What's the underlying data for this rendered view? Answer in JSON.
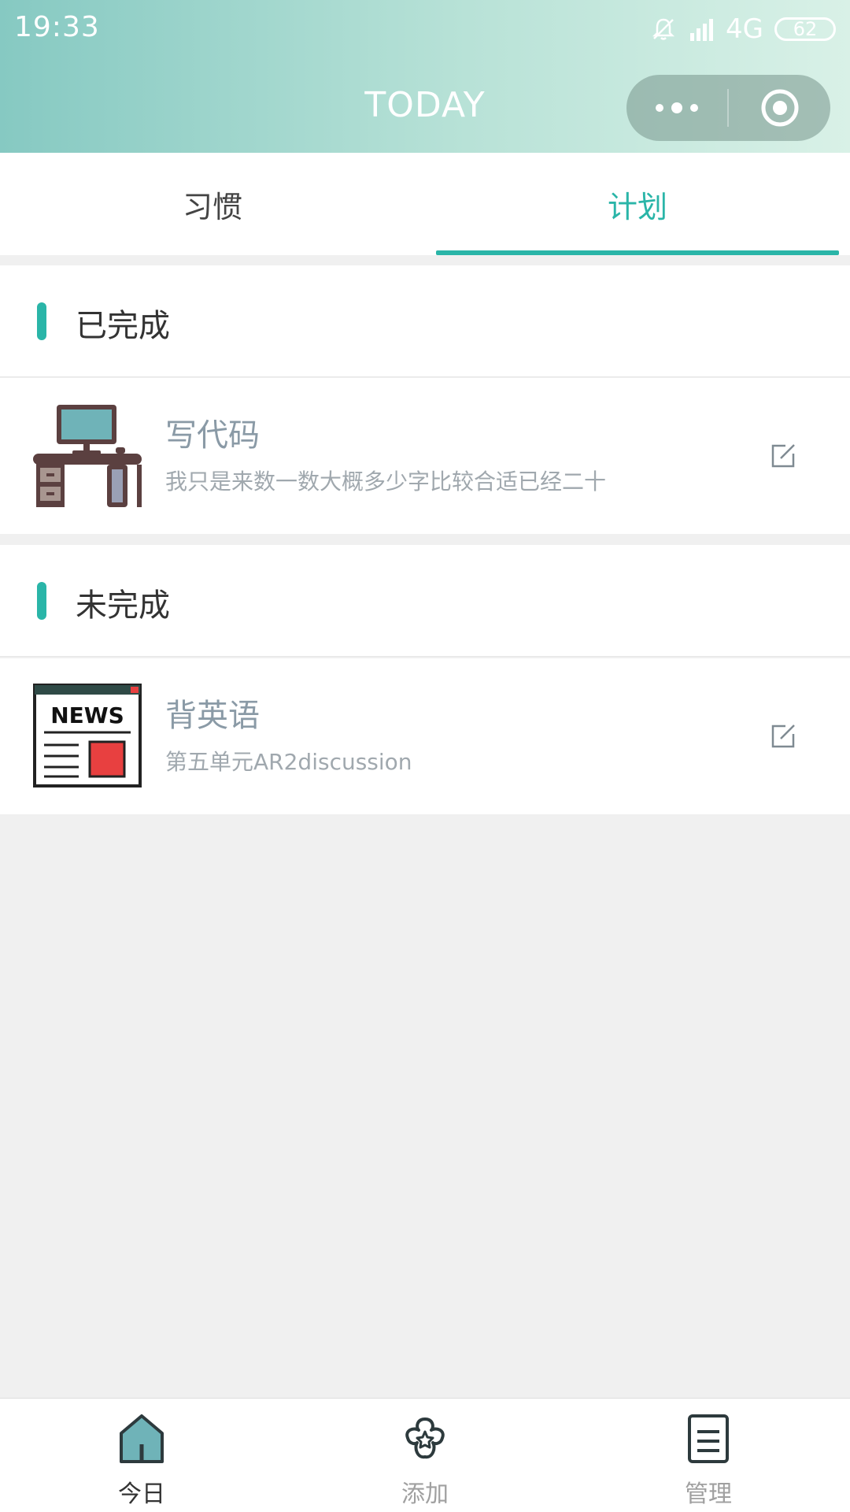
{
  "status_bar": {
    "time": "19:33",
    "network": "4G",
    "battery": "62"
  },
  "header": {
    "title": "TODAY"
  },
  "tabs": [
    {
      "label": "习惯",
      "active": false
    },
    {
      "label": "计划",
      "active": true
    }
  ],
  "sections": [
    {
      "title": "已完成",
      "items": [
        {
          "title": "写代码",
          "subtitle": "我只是来数一数大概多少字比较合适已经二十",
          "icon": "computer-desk-icon"
        }
      ]
    },
    {
      "title": "未完成",
      "items": [
        {
          "title": "背英语",
          "subtitle": "第五单元AR2discussion",
          "icon": "newspaper-icon",
          "icon_text": "NEWS"
        }
      ]
    }
  ],
  "bottom_nav": [
    {
      "label": "今日",
      "icon": "home-icon",
      "active": true
    },
    {
      "label": "添加",
      "icon": "flower-add-icon",
      "active": false
    },
    {
      "label": "管理",
      "icon": "document-icon",
      "active": false
    }
  ],
  "colors": {
    "accent": "#2ab5a8",
    "header_start": "#86c9c2",
    "header_end": "#d9f1e7"
  }
}
